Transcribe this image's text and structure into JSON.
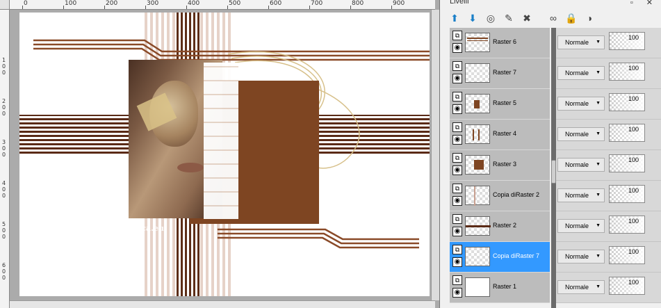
{
  "panel": {
    "title": "Livelli",
    "title_buttons": "▫ ✕",
    "toolbar": [
      {
        "icon": "new-raster-layer-icon",
        "glyph": "⬆"
      },
      {
        "icon": "new-vector-layer-icon",
        "glyph": "⬇"
      },
      {
        "icon": "layer-visibility-icon",
        "glyph": "◎"
      },
      {
        "icon": "paint-layer-icon",
        "glyph": "✎"
      },
      {
        "icon": "delete-layer-icon",
        "glyph": "✖"
      },
      {
        "icon": "link-icon",
        "glyph": "∞"
      },
      {
        "icon": "lock-icon",
        "glyph": "🔒"
      },
      {
        "icon": "mask-icon",
        "glyph": "◑"
      }
    ],
    "layers": [
      {
        "name": "Raster 6",
        "blend": "Normale",
        "opacity": "100",
        "selected": false,
        "thumb": "lines"
      },
      {
        "name": "Raster 7",
        "blend": "Normale",
        "opacity": "100",
        "selected": false,
        "thumb": "empty"
      },
      {
        "name": "Raster 5",
        "blend": "Normale",
        "opacity": "100",
        "selected": false,
        "thumb": "face"
      },
      {
        "name": "Raster 4",
        "blend": "Normale",
        "opacity": "100",
        "selected": false,
        "thumb": "bars"
      },
      {
        "name": "Raster 3",
        "blend": "Normale",
        "opacity": "100",
        "selected": false,
        "thumb": "square"
      },
      {
        "name": "Copia diRaster 2",
        "blend": "Normale",
        "opacity": "100",
        "selected": false,
        "thumb": "vline"
      },
      {
        "name": "Raster 2",
        "blend": "Normale",
        "opacity": "100",
        "selected": false,
        "thumb": "hline"
      },
      {
        "name": "Copia diRaster 7",
        "blend": "Normale",
        "opacity": "100",
        "selected": true,
        "thumb": "empty"
      },
      {
        "name": "Raster 1",
        "blend": "Normale",
        "opacity": "100",
        "selected": false,
        "thumb": "white"
      }
    ]
  },
  "ruler": {
    "top": [
      "0",
      "100",
      "200",
      "300",
      "400",
      "500",
      "600",
      "700",
      "800",
      "900"
    ],
    "left": [
      "1\n0\n0",
      "2\n0\n0",
      "3\n0\n0",
      "4\n0\n0",
      "5\n0\n0",
      "6\n0\n0"
    ]
  },
  "watermark": {
    "line1": "Pinuccia",
    "line2": "www.maidiregrafica.eu"
  },
  "colors": {
    "brown": "#7e4522",
    "dark": "#3a2418",
    "gold": "#d7c08a",
    "selected": "#3399ff"
  }
}
